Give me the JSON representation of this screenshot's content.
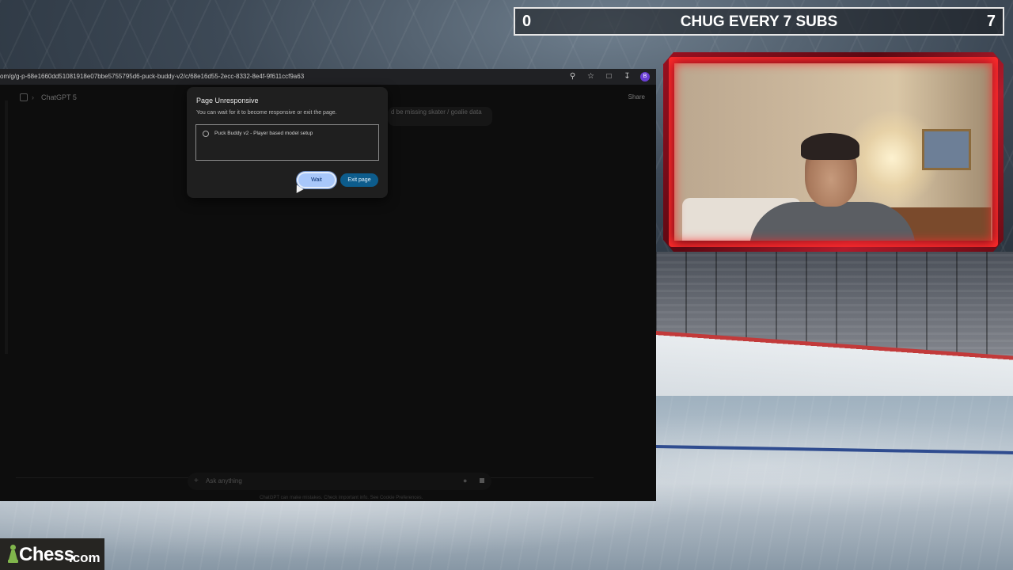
{
  "browser": {
    "url": "om/g/g-p-68e1660dd51081918e07bbe5755795d6-puck-buddy-v2/c/68e16d55-2ecc-8332-8e4f-9f611ccf9a63",
    "icons": [
      "zoom-icon",
      "star-icon",
      "extensions-icon",
      "download-icon",
      "profile-icon"
    ],
    "profile_initial": "B"
  },
  "chat": {
    "model_label": "ChatGPT 5",
    "share_label": "Share",
    "message_fragment": "d be missing skater / goalie data",
    "composer_placeholder": "Ask anything",
    "disclaimer": "ChatGPT can make mistakes. Check important info. See Cookie Preferences."
  },
  "dialog": {
    "title": "Page Unresponsive",
    "description": "You can wait for it to become responsive or exit the page.",
    "pages": [
      "Puck Buddy v2 - Player based model setup"
    ],
    "wait_label": "Wait",
    "exit_label": "Exit page"
  },
  "overlay": {
    "goal_count_left": "0",
    "goal_title": "CHUG EVERY 7 SUBS",
    "goal_count_right": "7",
    "logo_word": "Chess",
    "logo_tld": ".com"
  },
  "colors": {
    "wait_button": "#a8c7fa",
    "exit_button": "#0d5c8c",
    "frame_red": "#b01a2a",
    "chess_green": "#81b64c"
  }
}
